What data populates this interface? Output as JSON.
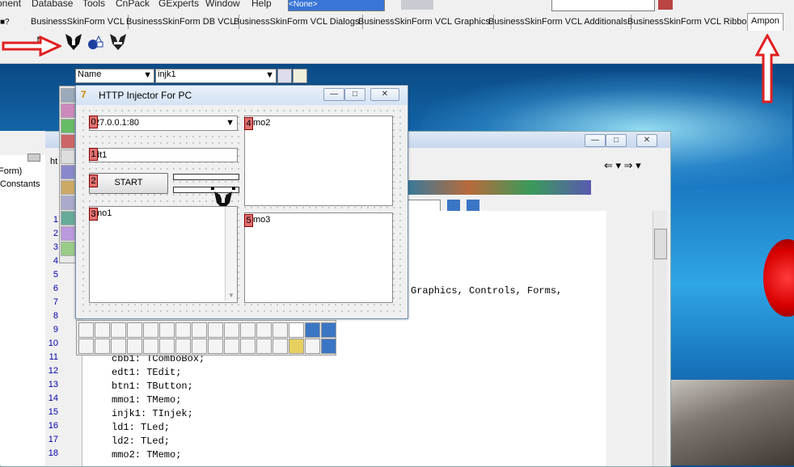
{
  "menu": [
    "onent",
    "Database",
    "Tools",
    "CnPack",
    "GExperts",
    "Window",
    "Help"
  ],
  "top_combo_value": "<None>",
  "palette_tabs": [
    "BusinessSkinForm VCL",
    "BusinessSkinForm DB VCL",
    "BusinessSkinForm VCL Dialogs",
    "BusinessSkinForm VCL Graphics",
    "BusinessSkinForm VCL Additionals",
    "BusinessSkinForm VCL Ribbon",
    "Ampon"
  ],
  "active_tab": "Ampon",
  "object_inspector": {
    "property_combo": "Name",
    "component_combo": "injk1",
    "tree_items": [
      "Form)",
      "Constants"
    ],
    "tab_label": "ht"
  },
  "form": {
    "title": "HTTP Injector For PC",
    "combo_value": "27.0.0.1:80",
    "edit_value": "dt1",
    "button_label": "START",
    "memo1": "mo1",
    "memo2": "mo2",
    "memo3": "mo3",
    "injector_label": "injk1",
    "tab_numbers": [
      "0",
      "1",
      "2",
      "3",
      "4",
      "5"
    ]
  },
  "code": {
    "line_numbers": [
      "1",
      "2",
      "3",
      "4",
      "5",
      "6",
      "7",
      "8",
      "9",
      "10",
      "11",
      "12",
      "13",
      "14",
      "15",
      "16",
      "17",
      "18"
    ],
    "uses_fragment": "Graphics, Controls, Forms,",
    "lines": [
      "cbb1: TComboBox;",
      "edt1: TEdit;",
      "btn1: TButton;",
      "mmo1: TMemo;",
      "injk1: TInjek;",
      "ld1: TLed;",
      "ld2: TLed;",
      "mmo2: TMemo;"
    ]
  },
  "colors": {
    "accent_red": "#e02020",
    "title_blue": "#d3e2f4"
  }
}
